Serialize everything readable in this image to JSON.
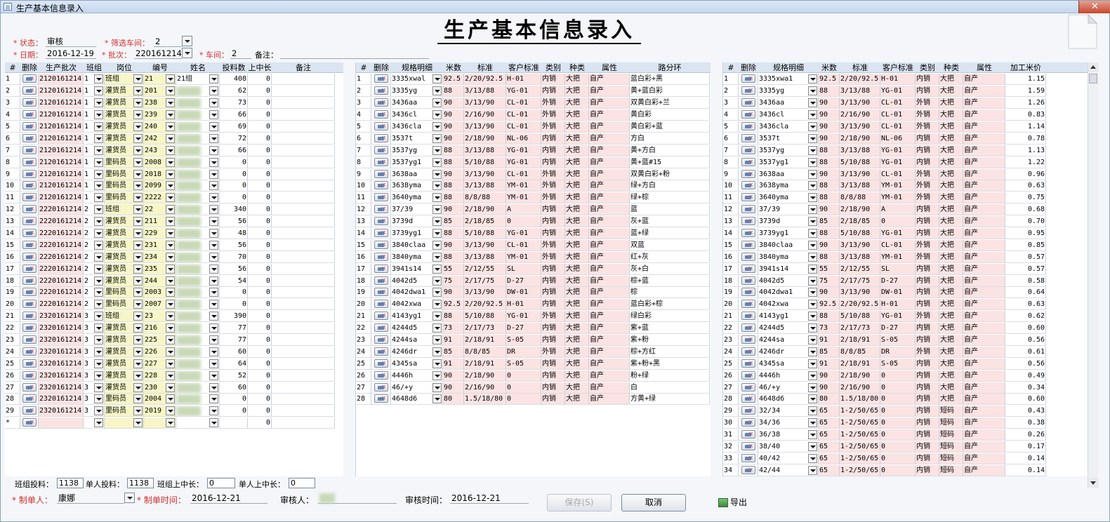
{
  "window": {
    "title": "生产基本信息录入",
    "close_glyph": "✕",
    "heading": "生产基本信息录入"
  },
  "filters": {
    "status_label": "* 状态：",
    "status_value": "审核",
    "shop_filter_label": "* 筛选车间：",
    "shop_filter_value": "2",
    "date_label": "* 日期：",
    "date_value": "2016-12-19",
    "batch_label": "* 批次：",
    "batch_value": "220161214",
    "shop_label": "* 车间：",
    "shop_value": "2",
    "remark_label": "备注："
  },
  "grid1": {
    "headers": [
      "#",
      "删除",
      "生产批次",
      "班组",
      "岗位",
      "编号",
      "姓名",
      "投料数",
      "上中长",
      "备注"
    ],
    "rows": [
      [
        "1",
        "2120161214",
        "1",
        "班组",
        "21",
        "21组",
        "408",
        "0"
      ],
      [
        "2",
        "2120161214",
        "1",
        "灌货员",
        "201",
        "",
        "62",
        "0"
      ],
      [
        "3",
        "2120161214",
        "1",
        "灌货员",
        "238",
        "",
        "73",
        "0"
      ],
      [
        "4",
        "2120161214",
        "1",
        "灌货员",
        "239",
        "",
        "66",
        "0"
      ],
      [
        "5",
        "2120161214",
        "1",
        "灌货员",
        "240",
        "",
        "69",
        "0"
      ],
      [
        "6",
        "2120161214",
        "1",
        "灌货员",
        "242",
        "",
        "72",
        "0"
      ],
      [
        "7",
        "2120161214",
        "1",
        "灌货员",
        "243",
        "",
        "66",
        "0"
      ],
      [
        "8",
        "2120161214",
        "1",
        "里码员",
        "2008",
        "",
        "0",
        "0"
      ],
      [
        "9",
        "2120161214",
        "1",
        "里码员",
        "2018",
        "",
        "0",
        "0"
      ],
      [
        "10",
        "2120161214",
        "1",
        "里码员",
        "2099",
        "",
        "0",
        "0"
      ],
      [
        "11",
        "2120161214",
        "1",
        "里码员",
        "2222",
        "",
        "0",
        "0"
      ],
      [
        "12",
        "2220161214",
        "2",
        "班组",
        "22",
        "",
        "340",
        "0"
      ],
      [
        "13",
        "2220161214",
        "2",
        "灌货员",
        "211",
        "",
        "56",
        "0"
      ],
      [
        "14",
        "2220161214",
        "2",
        "灌货员",
        "229",
        "",
        "48",
        "0"
      ],
      [
        "15",
        "2220161214",
        "2",
        "灌货员",
        "231",
        "",
        "56",
        "0"
      ],
      [
        "16",
        "2220161214",
        "2",
        "灌货员",
        "234",
        "",
        "70",
        "0"
      ],
      [
        "17",
        "2220161214",
        "2",
        "灌货员",
        "235",
        "",
        "56",
        "0"
      ],
      [
        "18",
        "2220161214",
        "2",
        "灌货员",
        "244",
        "",
        "54",
        "0"
      ],
      [
        "19",
        "2220161214",
        "2",
        "里码员",
        "2003",
        "",
        "0",
        "0"
      ],
      [
        "20",
        "2220161214",
        "2",
        "里码员",
        "2007",
        "",
        "0",
        "0"
      ],
      [
        "21",
        "2320161214",
        "3",
        "班组",
        "23",
        "",
        "390",
        "0"
      ],
      [
        "22",
        "2320161214",
        "3",
        "灌货员",
        "216",
        "",
        "77",
        "0"
      ],
      [
        "23",
        "2320161214",
        "3",
        "灌货员",
        "225",
        "",
        "77",
        "0"
      ],
      [
        "24",
        "2320161214",
        "3",
        "灌货员",
        "226",
        "",
        "60",
        "0"
      ],
      [
        "25",
        "2320161214",
        "3",
        "灌货员",
        "227",
        "",
        "64",
        "0"
      ],
      [
        "26",
        "2320161214",
        "3",
        "灌货员",
        "228",
        "",
        "52",
        "0"
      ],
      [
        "27",
        "2320161214",
        "3",
        "灌货员",
        "230",
        "",
        "60",
        "0"
      ],
      [
        "28",
        "2320161214",
        "3",
        "里码员",
        "2004",
        "",
        "0",
        "0"
      ],
      [
        "29",
        "2320161214",
        "3",
        "里码员",
        "2019",
        "",
        "0",
        "0"
      ],
      [
        "*",
        "",
        "",
        "",
        "",
        "",
        "",
        "0"
      ]
    ]
  },
  "grid2": {
    "headers": [
      "#",
      "删除",
      "规格明细",
      "米数",
      "标准",
      "客户标准",
      "类别",
      "种类",
      "属性",
      "路分环"
    ],
    "rows": [
      [
        "1",
        "3335xwal",
        "92.5",
        "2/20/92.5",
        "H-01",
        "内销",
        "大把",
        "自产",
        "蓝白彩+黑"
      ],
      [
        "2",
        "3335yg",
        "88",
        "3/13/88",
        "YG-01",
        "内销",
        "大把",
        "自产",
        "黄+蓝白彩"
      ],
      [
        "3",
        "3436aa",
        "90",
        "3/13/90",
        "CL-01",
        "外销",
        "大把",
        "自产",
        "双黄白彩+兰"
      ],
      [
        "4",
        "3436cl",
        "90",
        "2/16/90",
        "CL-01",
        "外销",
        "大把",
        "自产",
        "黄白彩"
      ],
      [
        "5",
        "3436cla",
        "90",
        "3/13/90",
        "CL-01",
        "外销",
        "大把",
        "自产",
        "黄白彩+蓝"
      ],
      [
        "6",
        "3537t",
        "90",
        "2/18/90",
        "NL-06",
        "内销",
        "大把",
        "自产",
        "方白"
      ],
      [
        "7",
        "3537yg",
        "88",
        "3/13/88",
        "YG-01",
        "内销",
        "大把",
        "自产",
        "黄+方白"
      ],
      [
        "8",
        "3537yg1",
        "88",
        "5/10/88",
        "YG-01",
        "内销",
        "大把",
        "自产",
        "黄+蓝#15"
      ],
      [
        "9",
        "3638aa",
        "90",
        "3/13/90",
        "CL-01",
        "外销",
        "大把",
        "自产",
        "双黄白彩+粉"
      ],
      [
        "10",
        "3638yma",
        "88",
        "3/13/88",
        "YM-01",
        "外销",
        "大把",
        "自产",
        "绿+方白"
      ],
      [
        "11",
        "3640yma",
        "88",
        "8/8/88",
        "YM-01",
        "外销",
        "大把",
        "自产",
        "绿+棕"
      ],
      [
        "12",
        "37/39",
        "90",
        "2/18/90",
        "A",
        "内销",
        "大把",
        "自产",
        "蓝"
      ],
      [
        "13",
        "3739d",
        "85",
        "2/18/85",
        "0",
        "内销",
        "大把",
        "自产",
        "灰+蓝"
      ],
      [
        "14",
        "3739yg1",
        "88",
        "5/10/88",
        "YG-01",
        "内销",
        "大把",
        "自产",
        "蓝+绿"
      ],
      [
        "15",
        "3840claa",
        "90",
        "3/13/90",
        "CL-01",
        "外销",
        "大把",
        "自产",
        "双蓝"
      ],
      [
        "16",
        "3840yma",
        "88",
        "3/13/88",
        "YM-01",
        "外销",
        "大把",
        "自产",
        "红+灰"
      ],
      [
        "17",
        "3941s14",
        "55",
        "2/12/55",
        "SL",
        "内销",
        "大把",
        "自产",
        "灰+白"
      ],
      [
        "18",
        "4042d5",
        "75",
        "2/17/75",
        "D-27",
        "内销",
        "大把",
        "自产",
        "棕+蓝"
      ],
      [
        "19",
        "4042dwa1",
        "90",
        "3/13/90",
        "DW-01",
        "内销",
        "大把",
        "自产",
        "棕"
      ],
      [
        "20",
        "4042xwa",
        "92.5",
        "2/20/92.5",
        "H-01",
        "内销",
        "大把",
        "自产",
        "蓝白彩+棕"
      ],
      [
        "21",
        "4143yg1",
        "88",
        "5/10/88",
        "YG-01",
        "外销",
        "大把",
        "自产",
        "绿白彩"
      ],
      [
        "22",
        "4244d5",
        "73",
        "2/17/73",
        "D-27",
        "内销",
        "大把",
        "自产",
        "紫+蓝"
      ],
      [
        "23",
        "4244sa",
        "91",
        "2/18/91",
        "S-05",
        "内销",
        "大把",
        "自产",
        "紫+粉"
      ],
      [
        "24",
        "4246dr",
        "85",
        "8/8/85",
        "DR",
        "外销",
        "大把",
        "自产",
        "棕+方红"
      ],
      [
        "25",
        "4345sa",
        "91",
        "2/18/91",
        "S-05",
        "内销",
        "大把",
        "自产",
        "紫+粉+黑"
      ],
      [
        "26",
        "4446h",
        "90",
        "2/18/90",
        "0",
        "内销",
        "大把",
        "自产",
        "粉+绿"
      ],
      [
        "27",
        "46/+y",
        "90",
        "2/16/90",
        "0",
        "内销",
        "大把",
        "自产",
        "白"
      ],
      [
        "28",
        "4648d6",
        "80",
        "1.5/18/80",
        "0",
        "内销",
        "大把",
        "自产",
        "方黄+绿"
      ]
    ]
  },
  "grid3": {
    "headers": [
      "#",
      "删除",
      "规格明细",
      "米数",
      "标准",
      "客户标准",
      "类别",
      "种类",
      "属性",
      "加工米价"
    ],
    "rows": [
      [
        "1",
        "3335xwa1",
        "92.5",
        "2/20/92.5",
        "H-01",
        "内销",
        "大把",
        "自产",
        "1.15"
      ],
      [
        "2",
        "3335yg",
        "88",
        "3/13/88",
        "YG-01",
        "内销",
        "大把",
        "自产",
        "1.59"
      ],
      [
        "3",
        "3436aa",
        "90",
        "3/13/90",
        "CL-01",
        "外销",
        "大把",
        "自产",
        "1.26"
      ],
      [
        "4",
        "3436cl",
        "90",
        "2/16/90",
        "CL-01",
        "外销",
        "大把",
        "自产",
        "0.83"
      ],
      [
        "5",
        "3436cla",
        "90",
        "3/13/90",
        "CL-01",
        "外销",
        "大把",
        "自产",
        "1.14"
      ],
      [
        "6",
        "3537t",
        "90",
        "2/18/90",
        "NL-06",
        "内销",
        "大把",
        "自产",
        "0.78"
      ],
      [
        "7",
        "3537yg",
        "88",
        "3/13/88",
        "YG-01",
        "内销",
        "大把",
        "自产",
        "1.13"
      ],
      [
        "8",
        "3537yg1",
        "88",
        "5/10/88",
        "YG-01",
        "内销",
        "大把",
        "自产",
        "1.22"
      ],
      [
        "9",
        "3638aa",
        "90",
        "3/13/90",
        "CL-01",
        "外销",
        "大把",
        "自产",
        "0.96"
      ],
      [
        "10",
        "3638yma",
        "88",
        "3/13/88",
        "YM-01",
        "外销",
        "大把",
        "自产",
        "0.63"
      ],
      [
        "11",
        "3640yma",
        "88",
        "8/8/88",
        "YM-01",
        "外销",
        "大把",
        "自产",
        "0.75"
      ],
      [
        "12",
        "37/39",
        "90",
        "2/18/90",
        "A",
        "内销",
        "大把",
        "自产",
        "0.68"
      ],
      [
        "13",
        "3739d",
        "85",
        "2/18/85",
        "0",
        "内销",
        "大把",
        "自产",
        "0.70"
      ],
      [
        "14",
        "3739yg1",
        "88",
        "5/10/88",
        "YG-01",
        "内销",
        "大把",
        "自产",
        "0.95"
      ],
      [
        "15",
        "3840claa",
        "90",
        "3/13/90",
        "CL-01",
        "外销",
        "大把",
        "自产",
        "0.85"
      ],
      [
        "16",
        "3840yma",
        "88",
        "3/13/88",
        "YM-01",
        "外销",
        "大把",
        "自产",
        "0.57"
      ],
      [
        "17",
        "3941s14",
        "55",
        "2/12/55",
        "SL",
        "内销",
        "大把",
        "自产",
        "0.57"
      ],
      [
        "18",
        "4042d5",
        "75",
        "2/17/75",
        "D-27",
        "内销",
        "大把",
        "自产",
        "0.58"
      ],
      [
        "19",
        "4042dwa1",
        "90",
        "3/13/90",
        "DW-01",
        "内销",
        "大把",
        "自产",
        "0.64"
      ],
      [
        "20",
        "4042xwa",
        "92.5",
        "2/20/92.5",
        "H-01",
        "内销",
        "大把",
        "自产",
        "0.63"
      ],
      [
        "21",
        "4143yg1",
        "88",
        "5/10/88",
        "YG-01",
        "外销",
        "大把",
        "自产",
        "0.62"
      ],
      [
        "22",
        "4244d5",
        "73",
        "2/17/73",
        "D-27",
        "内销",
        "大把",
        "自产",
        "0.60"
      ],
      [
        "23",
        "4244sa",
        "91",
        "2/18/91",
        "S-05",
        "内销",
        "大把",
        "自产",
        "0.56"
      ],
      [
        "24",
        "4246dr",
        "85",
        "8/8/85",
        "DR",
        "外销",
        "大把",
        "自产",
        "0.61"
      ],
      [
        "25",
        "4345sa",
        "91",
        "2/18/91",
        "S-05",
        "内销",
        "大把",
        "自产",
        "0.56"
      ],
      [
        "26",
        "4446h",
        "90",
        "2/18/90",
        "0",
        "内销",
        "大把",
        "自产",
        "0.49"
      ],
      [
        "27",
        "46/+y",
        "90",
        "2/16/90",
        "0",
        "内销",
        "大把",
        "自产",
        "0.34"
      ],
      [
        "28",
        "4648d6",
        "80",
        "1.5/18/80",
        "0",
        "内销",
        "大把",
        "自产",
        "0.60"
      ],
      [
        "29",
        "32/34",
        "65",
        "1-2/50/65",
        "0",
        "内销",
        "短码",
        "自产",
        "0.43"
      ],
      [
        "30",
        "34/36",
        "65",
        "1-2/50/65",
        "0",
        "内销",
        "短码",
        "自产",
        "0.38"
      ],
      [
        "31",
        "36/38",
        "65",
        "1-2/50/65",
        "0",
        "内销",
        "短码",
        "自产",
        "0.26"
      ],
      [
        "32",
        "38/40",
        "65",
        "1-2/50/65",
        "0",
        "内销",
        "短码",
        "自产",
        "0.17"
      ],
      [
        "33",
        "40/42",
        "65",
        "1-2/50/65",
        "0",
        "内销",
        "短码",
        "自产",
        "0.14"
      ],
      [
        "34",
        "42/44",
        "65",
        "1-2/50/65",
        "0",
        "内销",
        "短码",
        "自产",
        "0.14"
      ]
    ]
  },
  "totals": {
    "team_feed_label": "班组投料：",
    "team_feed_value": "1138",
    "person_feed_label": "单人投料：",
    "person_feed_value": "1138",
    "team_upper_label": "班组上中长：",
    "team_upper_value": "0",
    "person_upper_label": "单人上中长：",
    "person_upper_value": "0"
  },
  "footer": {
    "maker_label": "* 制单人：",
    "maker_value": "康娜",
    "make_time_label": "* 制单时间：",
    "make_time_value": "2016-12-21",
    "auditor_label": "审核人：",
    "audit_time_label": "审核时间：",
    "audit_time_value": "2016-12-21",
    "save_label": "保存(S)",
    "cancel_label": "取消",
    "export_label": "导出"
  }
}
